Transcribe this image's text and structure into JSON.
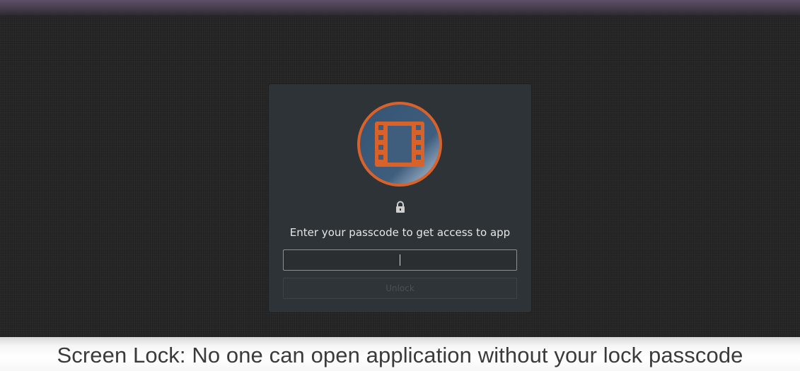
{
  "lock_screen": {
    "app_icon": "film-strip-icon",
    "lock_icon": "padlock-icon",
    "prompt": "Enter your passcode to get access to app",
    "passcode": {
      "value": "",
      "placeholder": ""
    },
    "unlock_label": "Unlock"
  },
  "caption": {
    "text": "Screen Lock: No one can open application without your lock passcode"
  },
  "colors": {
    "accent_orange": "#d9622b",
    "logo_blue": "#3c5a78",
    "card_background": "#2e3337",
    "screen_background": "#272727",
    "top_bar": "#5e4f68"
  }
}
